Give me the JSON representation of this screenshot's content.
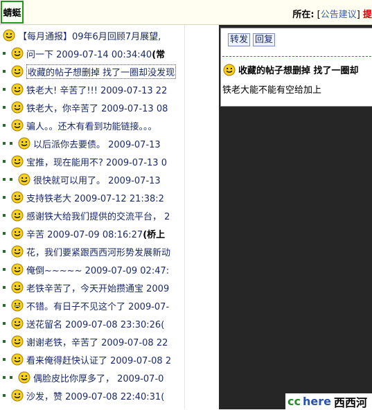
{
  "header": {
    "logo_text": "蜻蜓",
    "location_label": "所在:",
    "bracket_open": "[",
    "location_link": "公告建议",
    "bracket_close": "]",
    "extra": "提"
  },
  "threads": [
    {
      "indent": 0,
      "icon": "smile-icon",
      "title": "【每月通报】09年6月回顾7月展望, ",
      "first": true
    },
    {
      "indent": 1,
      "icon": "smile-icon",
      "title": "问一下 2009-07-14 00:34:40",
      "bold": "(常"
    },
    {
      "indent": 1,
      "icon": "smile-icon",
      "title": "收藏的帖子想删掉 找了一圈却没发现",
      "selected": true
    },
    {
      "indent": 1,
      "icon": "smile-icon",
      "title": "铁老大! 辛苦了!!! 2009-07-13 22"
    },
    {
      "indent": 1,
      "icon": "smile-icon",
      "title": "铁老大，你辛苦了 2009-07-13 08"
    },
    {
      "indent": 1,
      "icon": "smile-icon",
      "title": "骗人。。还木有看到功能链接。。。"
    },
    {
      "indent": 2,
      "icon": "smile-icon",
      "title": "以后派你去要债。 2009-07-13"
    },
    {
      "indent": 1,
      "icon": "smile-icon",
      "title": "宝推，现在能用不? 2009-07-13 0"
    },
    {
      "indent": 2,
      "icon": "smile-icon",
      "title": "很快就可以用了。 2009-07-13"
    },
    {
      "indent": 1,
      "icon": "smile-icon",
      "title": "支持铁老大 2009-07-12 21:38:2"
    },
    {
      "indent": 1,
      "icon": "smile-icon",
      "title": "感谢铁大给我们提供的交流平台， 2"
    },
    {
      "indent": 1,
      "icon": "smile-icon",
      "title": "辛苦 2009-07-09 08:16:27",
      "bold": "(桥上"
    },
    {
      "indent": 1,
      "icon": "smile-icon",
      "title": "花，我们要紧跟西西河形势发展新动"
    },
    {
      "indent": 1,
      "icon": "smile-icon",
      "title": "俺倒~~~~~ 2009-07-09 02:47:"
    },
    {
      "indent": 1,
      "icon": "smile-icon",
      "title": "老铁辛苦了，今天开始攒通宝 2009"
    },
    {
      "indent": 1,
      "icon": "grin-icon",
      "title": "不错。有日子不见这个了 2009-07-"
    },
    {
      "indent": 1,
      "icon": "smile-icon",
      "title": "送花留名 2009-07-08 23:30:26("
    },
    {
      "indent": 1,
      "icon": "smile-icon",
      "title": "谢谢老铁，辛苦了 2009-07-08 22"
    },
    {
      "indent": 1,
      "icon": "smile-icon",
      "title": "看来俺得赶快认证了 2009-07-08 2"
    },
    {
      "indent": 2,
      "icon": "smile-icon",
      "title": "偶脸皮比你厚多了， 2009-07-0"
    },
    {
      "indent": 1,
      "icon": "smile-icon",
      "title": "沙发，赞 2009-07-08 22:40:31("
    }
  ],
  "post": {
    "forward_label": "转发",
    "reply_label": "回复",
    "title": "收藏的帖子想删掉 找了一圈却",
    "body": "铁老大能不能有空给加上"
  },
  "brand": {
    "cc": "cc",
    "here": "here",
    "name": "西西河"
  },
  "colors": {
    "link": "#1a2a6c",
    "accent_red": "#d00000",
    "dark_panel": "#262626",
    "logo_border": "#1c9a1c"
  }
}
